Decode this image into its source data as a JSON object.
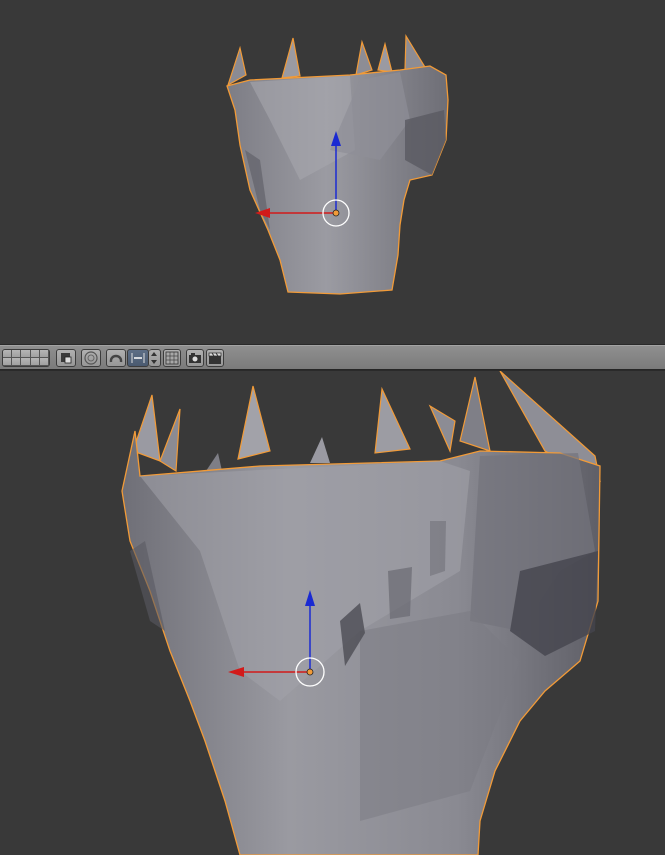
{
  "app": "3D Viewport",
  "header": {
    "layer_count": 10,
    "buttons": [
      "layers-grid",
      "lock-camera",
      "proportional-edit",
      "snap-magnet",
      "snap-target",
      "snap-arrows",
      "render-layers",
      "camera-icon",
      "clapper-icon"
    ]
  },
  "colors": {
    "background": "#393939",
    "object_outline": "#f29b38",
    "x_axis": "#d21a1a",
    "z_axis": "#1a2ad2",
    "mesh": "#8a8a92"
  },
  "icons": [
    "layers-grid-icon",
    "lock-icon",
    "circle-icon",
    "magnet-icon",
    "snap-target-icon",
    "arrows-updown-icon",
    "grid-icon",
    "camera-icon",
    "clapper-icon"
  ]
}
